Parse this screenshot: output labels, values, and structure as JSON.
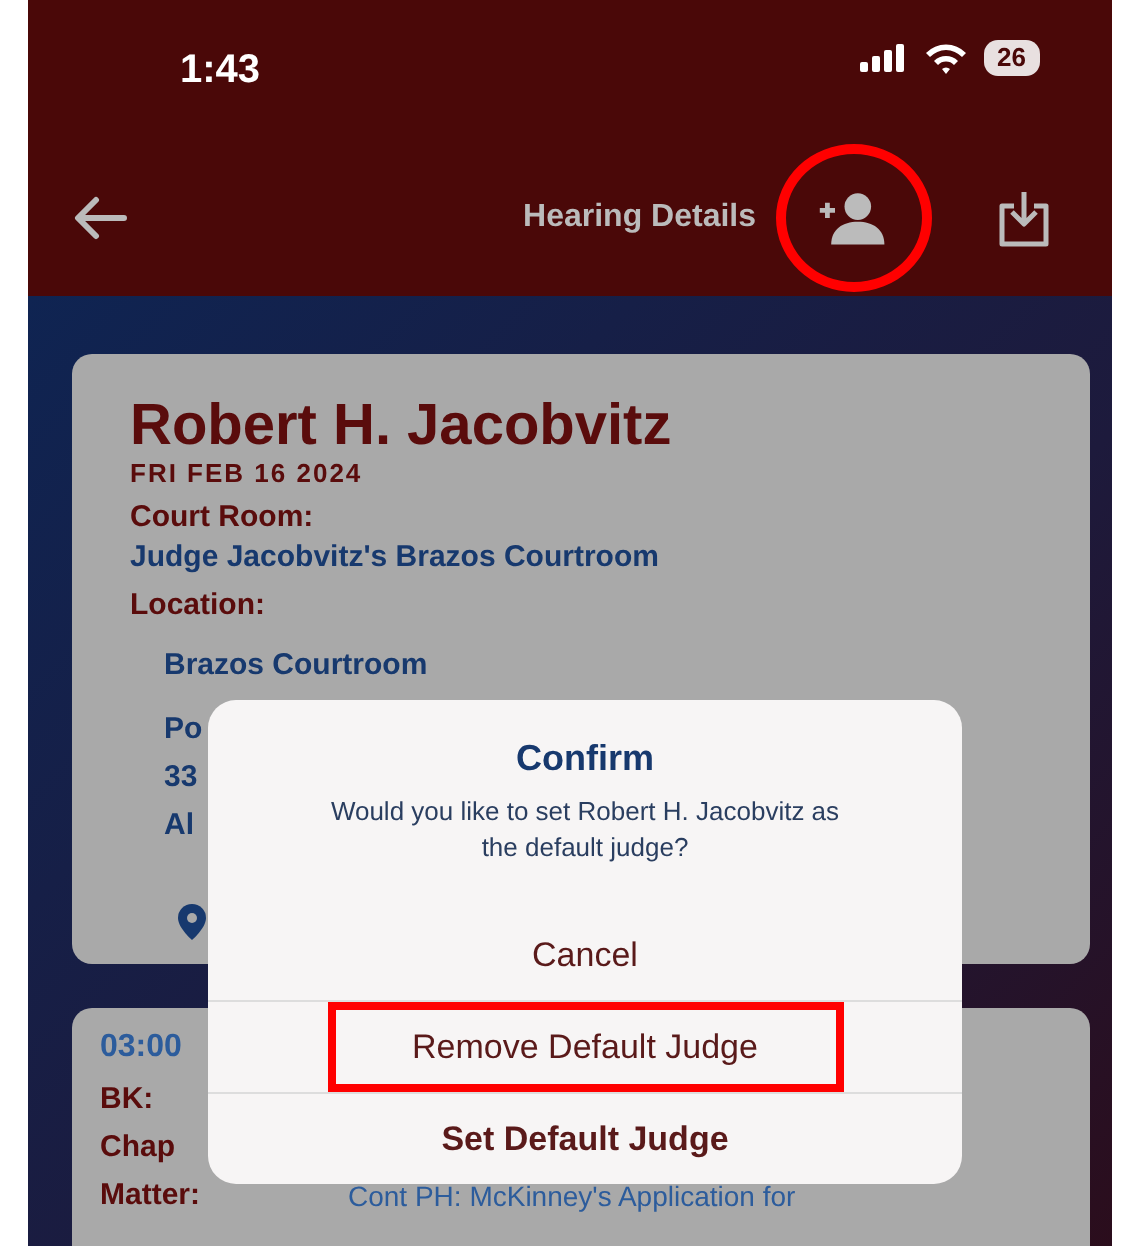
{
  "status_bar": {
    "time": "1:43",
    "battery": "26"
  },
  "nav": {
    "title": "Hearing Details",
    "add_judge_circled": true
  },
  "judge_card": {
    "name": "Robert H. Jacobvitz",
    "date": "FRI FEB 16 2024",
    "fields": [
      {
        "label": "Court Room:",
        "value": "Judge Jacobvitz's Brazos Courtroom"
      },
      {
        "label": "Location:"
      }
    ],
    "address_lines": [
      "Brazos Courtroom",
      "Po",
      "33",
      "Al"
    ]
  },
  "hearing_card": {
    "time": "03:00",
    "rows": [
      {
        "label": "BK:"
      },
      {
        "label": "Chap"
      },
      {
        "label": "Matter:",
        "value": "Cont PH: McKinney's Application for"
      }
    ]
  },
  "dialog": {
    "title": "Confirm",
    "message": "Would you like to set Robert H. Jacobvitz as the default judge?",
    "actions": [
      {
        "label": "Cancel",
        "bold": false,
        "highlighted": false
      },
      {
        "label": "Remove Default Judge",
        "bold": false,
        "highlighted": true
      },
      {
        "label": "Set Default Judge",
        "bold": true,
        "highlighted": false
      }
    ]
  }
}
